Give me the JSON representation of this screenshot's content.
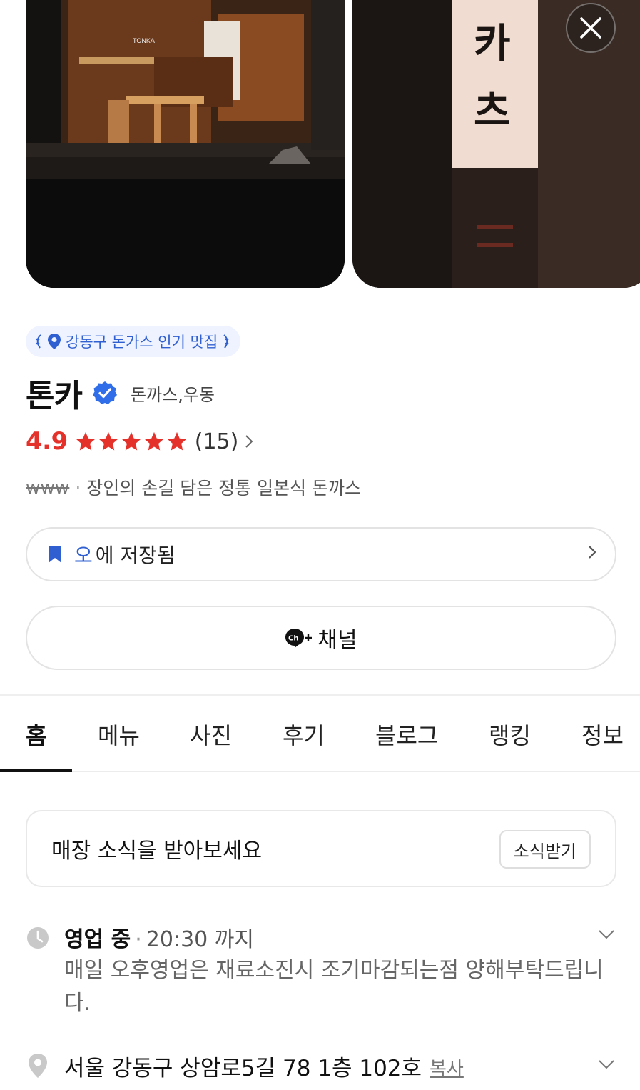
{
  "photos": {
    "photo1_sign": "TONKA",
    "photo2_sign": "카\n츠"
  },
  "badge": {
    "label": "강동구 돈가스 인기 맛집"
  },
  "place": {
    "name": "톤카",
    "category": "돈까스,우동"
  },
  "rating": {
    "score": "4.9",
    "stars": 5,
    "review_count": "(15)"
  },
  "description": {
    "www": "www",
    "separator": "·",
    "text": "장인의 손길 담은 정통 일본식 돈까스"
  },
  "save": {
    "folder": "오",
    "suffix": "에 저장됨"
  },
  "channel": {
    "label": "채널"
  },
  "tabs": [
    {
      "label": "홈"
    },
    {
      "label": "메뉴"
    },
    {
      "label": "사진"
    },
    {
      "label": "후기"
    },
    {
      "label": "블로그"
    },
    {
      "label": "랭킹"
    },
    {
      "label": "정보"
    }
  ],
  "news": {
    "text": "매장 소식을 받아보세요",
    "button": "소식받기"
  },
  "hours": {
    "status": "영업 중",
    "separator": "·",
    "time": "20:30 까지",
    "note": "매일 오후영업은 재료소진시 조기마감되는점 양해부탁드립니다."
  },
  "address": {
    "text": "서울 강동구 상암로5길 78 1층 102호",
    "copy": "복사"
  },
  "colors": {
    "accent_blue": "#2f5fd0",
    "rating_red": "#e4322b",
    "badge_bg": "#eef3ff"
  }
}
